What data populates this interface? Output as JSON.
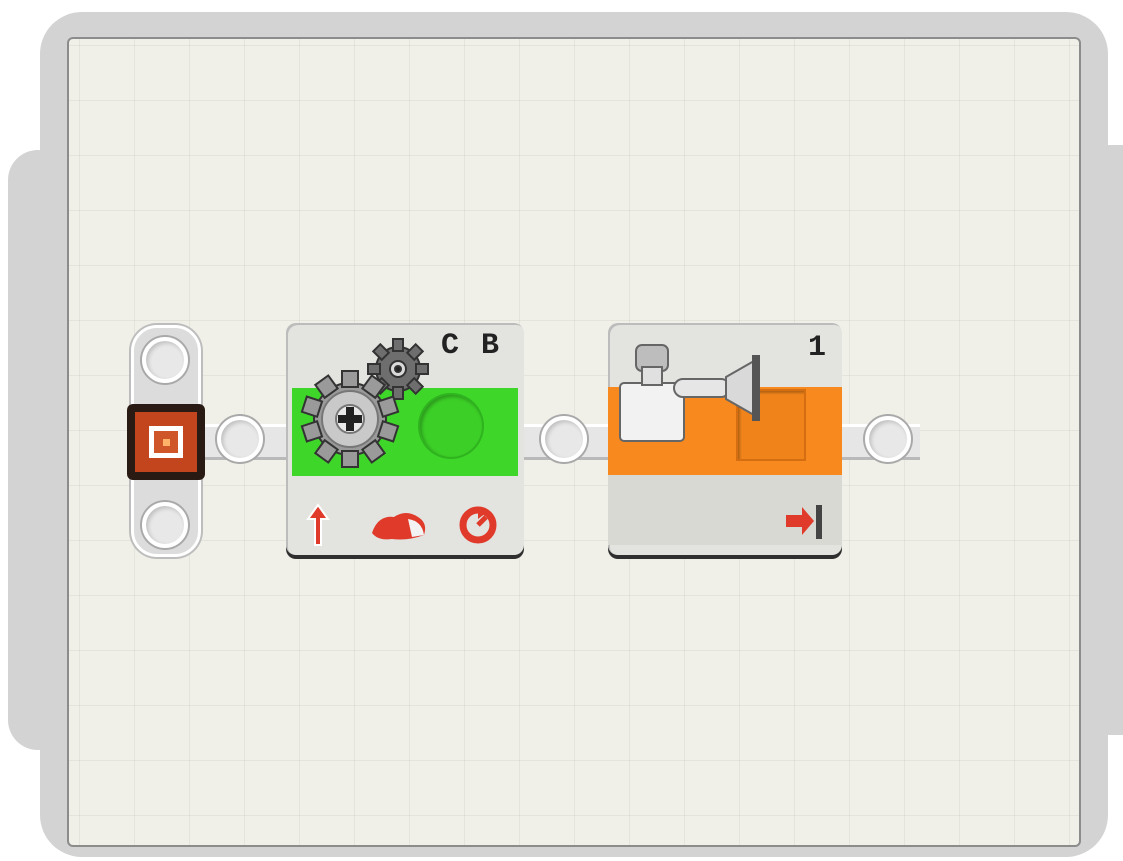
{
  "motor_block": {
    "ports_label": "C B",
    "color": "#3fd62a",
    "icons": [
      "gears-icon",
      "direction-arrow-icon",
      "power-icon",
      "duration-icon"
    ]
  },
  "sound_block": {
    "port_label": "1",
    "color": "#f7891f",
    "icons": [
      "sound-sensor-icon",
      "data-output-icon"
    ]
  }
}
